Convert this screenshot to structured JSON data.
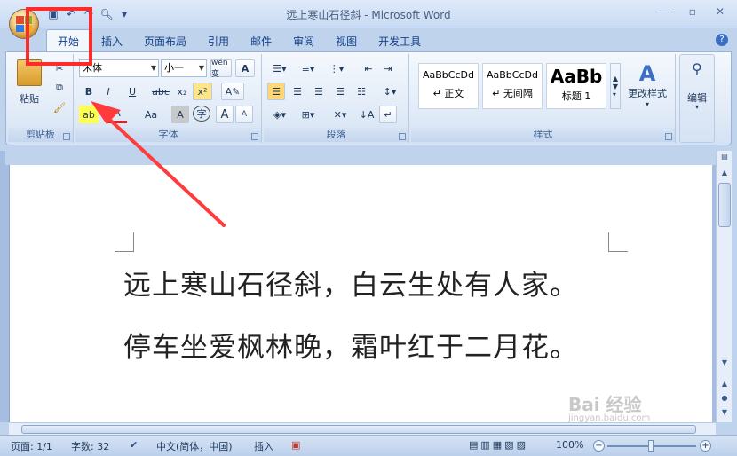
{
  "window": {
    "title": "远上寒山石径斜 - Microsoft Word",
    "minimize_icon": "minimize-icon",
    "restore_icon": "restore-icon",
    "close_icon": "close-icon"
  },
  "quick_access": [
    "save-icon",
    "undo-icon",
    "redo-icon",
    "print-preview-icon",
    "customize-icon"
  ],
  "tabs": [
    {
      "label": "开始",
      "active": true
    },
    {
      "label": "插入"
    },
    {
      "label": "页面布局"
    },
    {
      "label": "引用"
    },
    {
      "label": "邮件"
    },
    {
      "label": "审阅"
    },
    {
      "label": "视图"
    },
    {
      "label": "开发工具"
    }
  ],
  "ribbon": {
    "clipboard": {
      "paste_label": "粘贴",
      "group_label": "剪贴板"
    },
    "font": {
      "font_name": "宋体",
      "font_size": "小一",
      "wen_label": "wén 变",
      "bold": "B",
      "italic": "I",
      "underline": "U",
      "strike": "abc",
      "subscript": "x₂",
      "superscript": "x²",
      "highlight": "ab",
      "color": "A",
      "case": "Aa",
      "shade": "A",
      "enclose": "字",
      "grow": "A",
      "shrink": "A",
      "group_label": "字体"
    },
    "paragraph": {
      "group_label": "段落"
    },
    "styles": {
      "items": [
        {
          "sample": "AaBbCcDd",
          "name": "↵ 正文"
        },
        {
          "sample": "AaBbCcDd",
          "name": "↵ 无间隔"
        },
        {
          "sample": "AaBb",
          "name": "标题 1"
        }
      ],
      "change_styles_label": "更改样式",
      "group_label": "样式"
    },
    "editing": {
      "label": "编辑"
    }
  },
  "document": {
    "lines": [
      "远上寒山石径斜，白云生处有人家。",
      "停车坐爱枫林晚，霜叶红于二月花。"
    ]
  },
  "status": {
    "page": "页面: 1/1",
    "words": "字数: 32",
    "language": "中文(简体，中国)",
    "mode": "插入",
    "zoom": "100%",
    "zoom_minus": "−",
    "zoom_plus": "+"
  },
  "watermark": {
    "text": "Bai 经验",
    "url": "jingyan.baidu.com"
  },
  "colors": {
    "accent": "#15428b",
    "annotation": "#ff2b2b",
    "ribbon_bg": "#dfe9f7"
  }
}
